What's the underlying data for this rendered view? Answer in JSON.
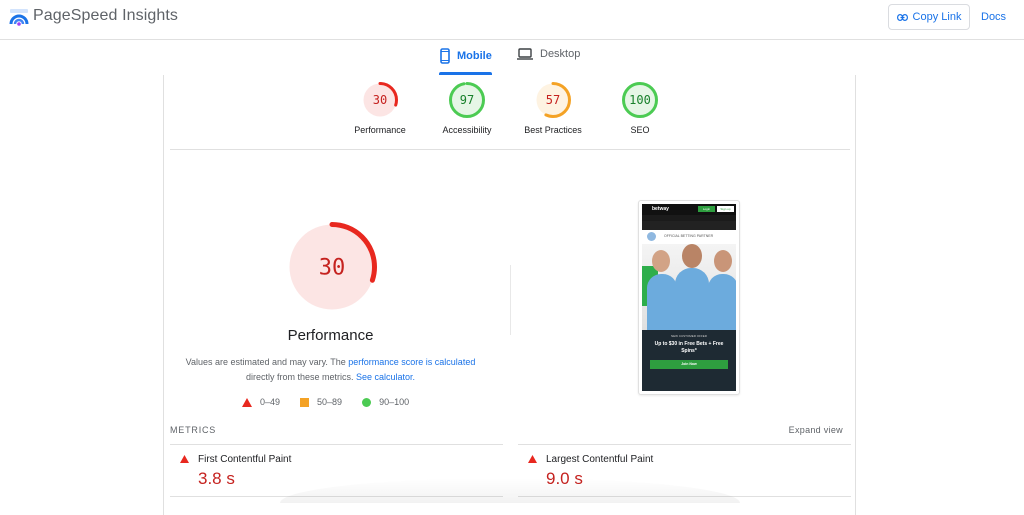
{
  "header": {
    "brand": "PageSpeed Insights",
    "copy_link_label": "Copy Link",
    "docs_label": "Docs"
  },
  "tabs": [
    {
      "label": "Mobile",
      "icon": "smartphone-icon",
      "active": true
    },
    {
      "label": "Desktop",
      "icon": "laptop-icon",
      "active": false
    }
  ],
  "gauges": [
    {
      "label": "Performance",
      "score": 30,
      "rating": "fail"
    },
    {
      "label": "Accessibility",
      "score": 97,
      "rating": "pass"
    },
    {
      "label": "Best Practices",
      "score": 57,
      "rating": "average"
    },
    {
      "label": "SEO",
      "score": 100,
      "rating": "pass"
    }
  ],
  "colors": {
    "fail": "#e8281f",
    "fail_bg": "#fce5e4",
    "fail_text": "#c5221f",
    "average": "#f4a225",
    "average_bg": "#fef3e2",
    "average_text": "#c5221f",
    "pass": "#4ccb53",
    "pass_bg": "#e6f6e6",
    "pass_text": "#18802b",
    "accent": "#1a73e8"
  },
  "performance": {
    "score": "30",
    "title": "Performance",
    "desc_prefix": "Values are estimated and may vary. The ",
    "desc_link1": "performance score is calculated",
    "desc_middle": " directly from these metrics. ",
    "desc_link2": "See calculator.",
    "legend": [
      {
        "shape": "triangle",
        "range": "0–49"
      },
      {
        "shape": "square",
        "range": "50–89"
      },
      {
        "shape": "circle",
        "range": "90–100"
      }
    ]
  },
  "screenshot": {
    "brand": "betway",
    "login": "Login",
    "signup": "Sign up",
    "partner": "OFFICIAL BETTING PARTNER",
    "offer_kicker": "NEW CUSTOMER OFFER",
    "offer": "Up to $30 in Free Bets + Free Spins*",
    "cta": "Join Now"
  },
  "metrics": {
    "heading": "METRICS",
    "expand_label": "Expand view",
    "items": [
      {
        "name": "First Contentful Paint",
        "value": "3.8 s",
        "rating": "fail"
      },
      {
        "name": "Largest Contentful Paint",
        "value": "9.0 s",
        "rating": "fail"
      }
    ]
  }
}
